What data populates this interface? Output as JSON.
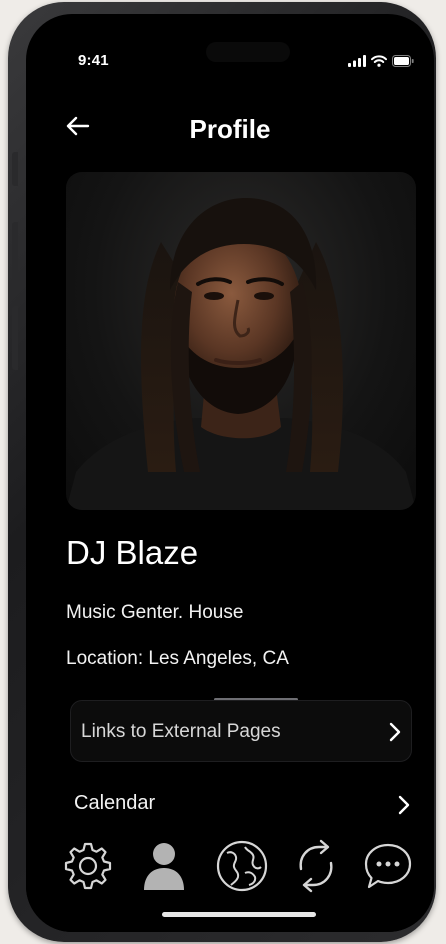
{
  "status_bar": {
    "time": "9:41",
    "icons": [
      "cellular-signal-icon",
      "wifi-icon",
      "battery-icon"
    ]
  },
  "header": {
    "title": "Profile",
    "back_icon": "arrow-left-icon"
  },
  "profile": {
    "name": "DJ Blaze",
    "genre": "Music Genter. House",
    "location": "Location:  Les Angeles,  CA",
    "photo_icon": "profile-photo"
  },
  "rows": {
    "links_label": "Links to External Pages",
    "calendar_label": "Calendar",
    "chevron_icon": "chevron-right-icon"
  },
  "tab_bar": {
    "tabs": [
      {
        "icon": "gear-icon",
        "active": false
      },
      {
        "icon": "user-icon",
        "active": true
      },
      {
        "icon": "globe-icon",
        "active": false
      },
      {
        "icon": "refresh-icon",
        "active": false
      },
      {
        "icon": "chat-bubble-icon",
        "active": false
      }
    ],
    "active_color": "#b3b3b3",
    "inactive_color": "#d6d6d6"
  },
  "colors": {
    "background": "#000000",
    "text": "#ffffff",
    "frame": "#1c1c1e"
  }
}
